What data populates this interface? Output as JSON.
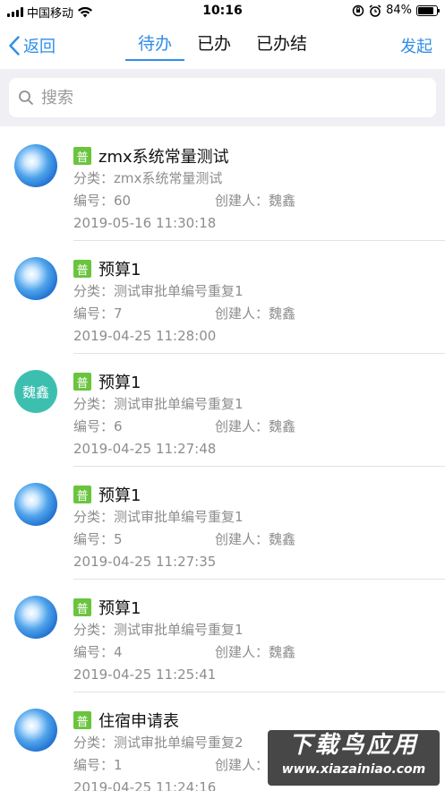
{
  "status_bar": {
    "carrier": "中国移动",
    "time": "10:16",
    "battery_text": "84%",
    "battery_level": 0.84
  },
  "nav": {
    "back_label": "返回",
    "tabs": [
      {
        "label": "待办",
        "active": true
      },
      {
        "label": "已办",
        "active": false
      },
      {
        "label": "已办结",
        "active": false
      }
    ],
    "action_label": "发起"
  },
  "search": {
    "placeholder": "搜索"
  },
  "labels": {
    "category_prefix": "分类：",
    "number_prefix": "编号：",
    "creator_prefix": "创建人："
  },
  "items": [
    {
      "badge": "普",
      "title": "zmx系统常量测试",
      "category": "分类：zmx系统常量测试",
      "number": "编号：60",
      "creator": "创建人：魏鑫",
      "datetime": "2019-05-16 11:30:18",
      "avatar": "sky"
    },
    {
      "badge": "普",
      "title": "预算1",
      "category": "分类：测试审批单编号重复1",
      "number": "编号：7",
      "creator": "创建人：魏鑫",
      "datetime": "2019-04-25 11:28:00",
      "avatar": "sky"
    },
    {
      "badge": "普",
      "title": "预算1",
      "category": "分类：测试审批单编号重复1",
      "number": "编号：6",
      "creator": "创建人：魏鑫",
      "datetime": "2019-04-25 11:27:48",
      "avatar": "text",
      "avatar_text": "魏鑫"
    },
    {
      "badge": "普",
      "title": "预算1",
      "category": "分类：测试审批单编号重复1",
      "number": "编号：5",
      "creator": "创建人：魏鑫",
      "datetime": "2019-04-25 11:27:35",
      "avatar": "sky"
    },
    {
      "badge": "普",
      "title": "预算1",
      "category": "分类：测试审批单编号重复1",
      "number": "编号：4",
      "creator": "创建人：魏鑫",
      "datetime": "2019-04-25 11:25:41",
      "avatar": "sky"
    },
    {
      "badge": "普",
      "title": "住宿申请表",
      "category": "分类：测试审批单编号重复2",
      "number": "编号：1",
      "creator": "创建人：",
      "datetime": "2019-04-25 11:24:16",
      "avatar": "sky"
    }
  ],
  "watermark": {
    "top": "下载鸟应用",
    "bottom": "www.xiazainiao.com"
  },
  "colors": {
    "accent": "#2f8ee8",
    "badge": "#6ac43e",
    "avatar_text_bg": "#3dbfb0"
  }
}
